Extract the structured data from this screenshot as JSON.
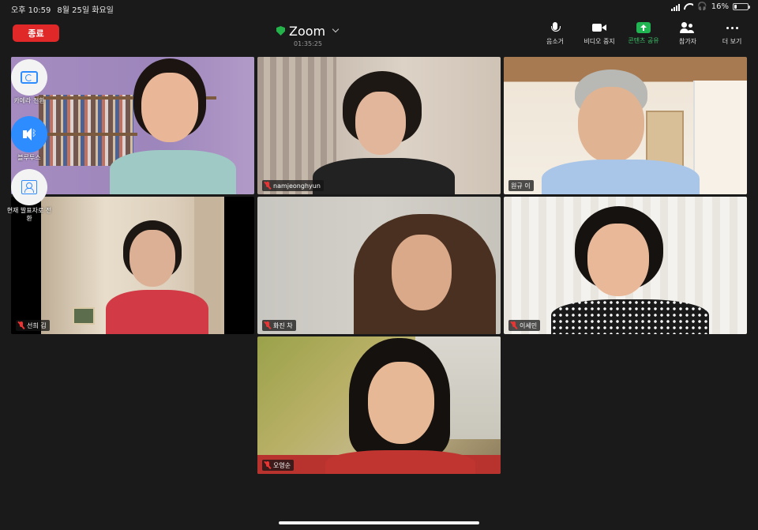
{
  "status_bar": {
    "time": "오후 10:59",
    "date": "8월 25일 화요일",
    "battery": "16%",
    "battery_level": 0.16
  },
  "toolbar": {
    "end_label": "종료",
    "title": "Zoom",
    "timer": "01:35:25",
    "buttons": [
      {
        "label": "음소거",
        "icon": "mic-icon"
      },
      {
        "label": "비디오 중지",
        "icon": "video-icon"
      },
      {
        "label": "콘텐츠 공유",
        "icon": "share-icon"
      },
      {
        "label": "참가자",
        "icon": "participants-icon"
      },
      {
        "label": "더 보기",
        "icon": "more-icon"
      }
    ]
  },
  "side_controls": {
    "camera_switch": "카메라 전환",
    "audio": "블루투스",
    "presenter": "현재 발표자로 전환"
  },
  "participants": [
    {
      "name": "",
      "muted": false,
      "active_speaker": true
    },
    {
      "name": "namjeonghyun",
      "muted": true
    },
    {
      "name": "원규 이",
      "muted": false
    },
    {
      "name": "선희 김",
      "muted": true
    },
    {
      "name": "화진 차",
      "muted": true
    },
    {
      "name": "이세민",
      "muted": true
    },
    {
      "name": "오영순",
      "muted": true
    }
  ],
  "colors": {
    "background": "#1a1a1a",
    "end_button": "#e02828",
    "share_green": "#20b552",
    "active_speaker_border": "#23d160",
    "muted_red": "#e33333",
    "accent_blue": "#2d8cff"
  }
}
